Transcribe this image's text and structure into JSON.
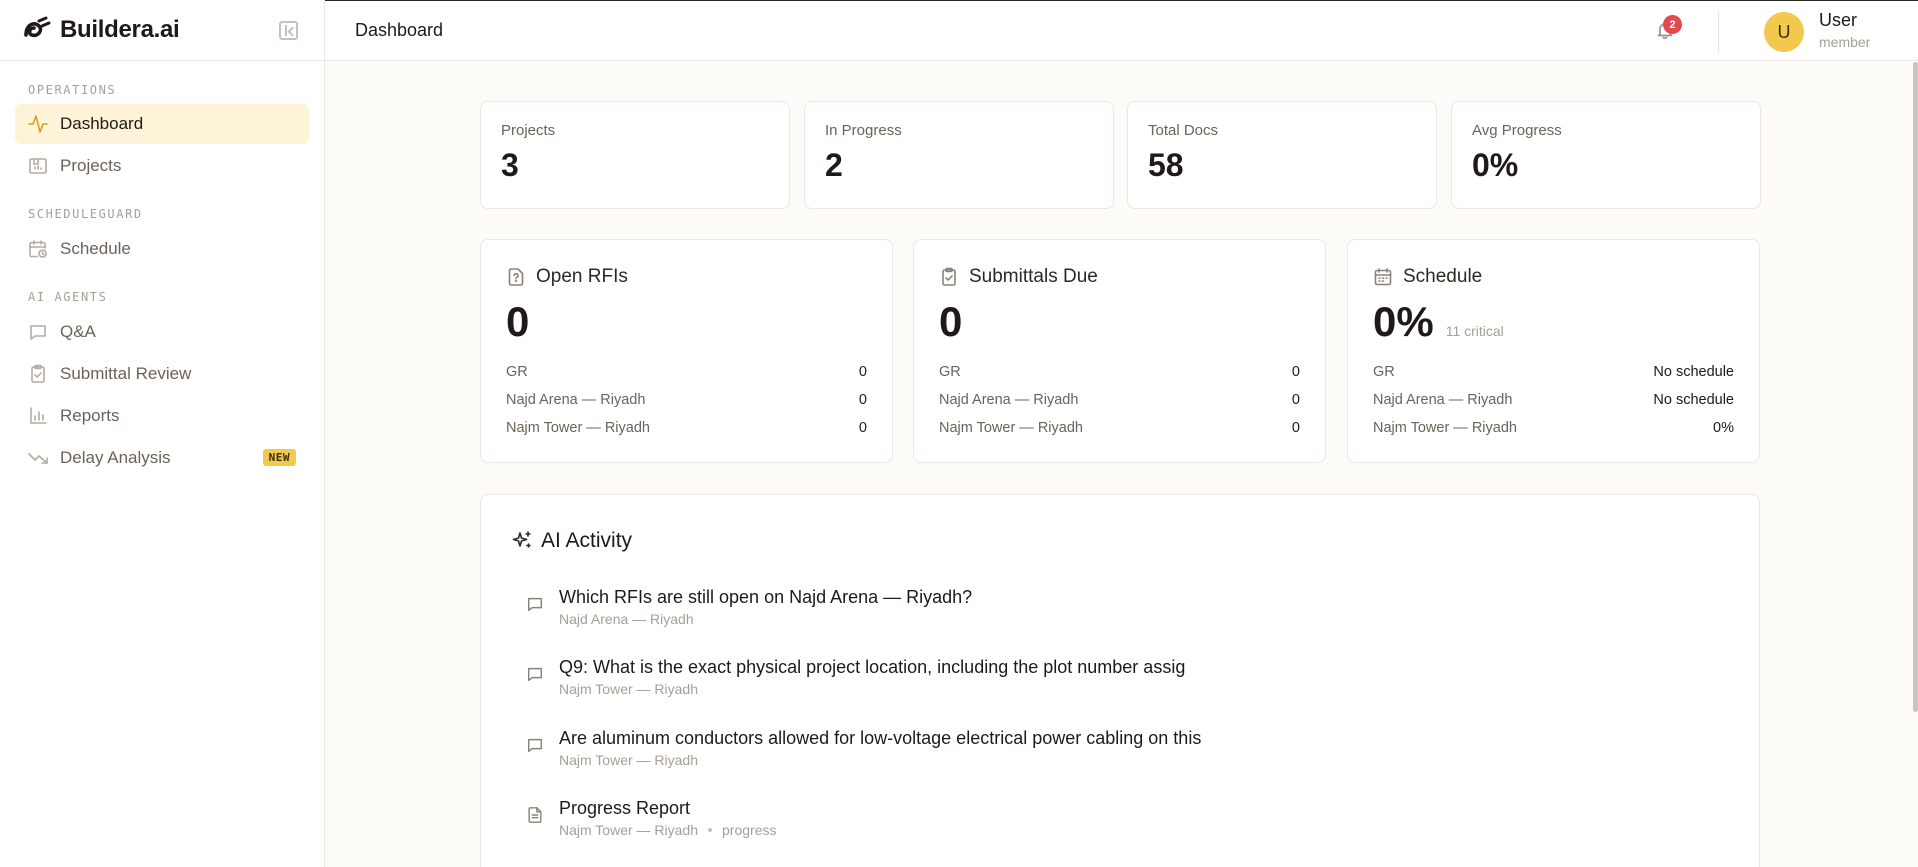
{
  "app": {
    "brand": "Buildera.ai"
  },
  "sidebar": {
    "sections": [
      {
        "label": "OPERATIONS"
      },
      {
        "label": "SCHEDULEGUARD"
      },
      {
        "label": "AI AGENTS"
      }
    ],
    "items": [
      {
        "label": "Dashboard",
        "icon": "activity-icon",
        "active": true
      },
      {
        "label": "Projects",
        "icon": "folder-icon"
      },
      {
        "label": "Schedule",
        "icon": "calendar-clock-icon"
      },
      {
        "label": "Q&A",
        "icon": "chat-icon"
      },
      {
        "label": "Submittal Review",
        "icon": "clipboard-check-icon"
      },
      {
        "label": "Reports",
        "icon": "bar-chart-icon"
      },
      {
        "label": "Delay Analysis",
        "icon": "trending-down-icon",
        "badge": "NEW"
      }
    ]
  },
  "header": {
    "title": "Dashboard",
    "notifications": "2",
    "user": {
      "initial": "U",
      "name": "User",
      "role": "member"
    }
  },
  "stats": [
    {
      "label": "Projects",
      "value": "3"
    },
    {
      "label": "In Progress",
      "value": "2"
    },
    {
      "label": "Total Docs",
      "value": "58"
    },
    {
      "label": "Avg Progress",
      "value": "0%"
    }
  ],
  "summaries": [
    {
      "title": "Open RFIs",
      "value": "0",
      "sub": "",
      "rows": [
        {
          "name": "GR",
          "value": "0"
        },
        {
          "name": "Najd Arena — Riyadh",
          "value": "0"
        },
        {
          "name": "Najm Tower — Riyadh",
          "value": "0"
        }
      ]
    },
    {
      "title": "Submittals Due",
      "value": "0",
      "sub": "",
      "rows": [
        {
          "name": "GR",
          "value": "0"
        },
        {
          "name": "Najd Arena — Riyadh",
          "value": "0"
        },
        {
          "name": "Najm Tower — Riyadh",
          "value": "0"
        }
      ]
    },
    {
      "title": "Schedule",
      "value": "0%",
      "sub": "11 critical",
      "rows": [
        {
          "name": "GR",
          "value": "No schedule"
        },
        {
          "name": "Najd Arena — Riyadh",
          "value": "No schedule"
        },
        {
          "name": "Najm Tower — Riyadh",
          "value": "0%"
        }
      ]
    }
  ],
  "activity": {
    "title": "AI Activity",
    "items": [
      {
        "text": "Which RFIs are still open on Najd Arena — Riyadh?",
        "project": "Najd Arena — Riyadh",
        "tag": "",
        "icon": "chat-icon"
      },
      {
        "text": "Q9: What is the exact physical project location, including the plot number assig",
        "project": "Najm Tower — Riyadh",
        "tag": "",
        "icon": "chat-icon"
      },
      {
        "text": "Are aluminum conductors allowed for low-voltage electrical power cabling on this",
        "project": "Najm Tower — Riyadh",
        "tag": "",
        "icon": "chat-icon"
      },
      {
        "text": "Progress Report",
        "project": "Najm Tower — Riyadh",
        "tag": "progress",
        "icon": "document-icon"
      }
    ]
  }
}
